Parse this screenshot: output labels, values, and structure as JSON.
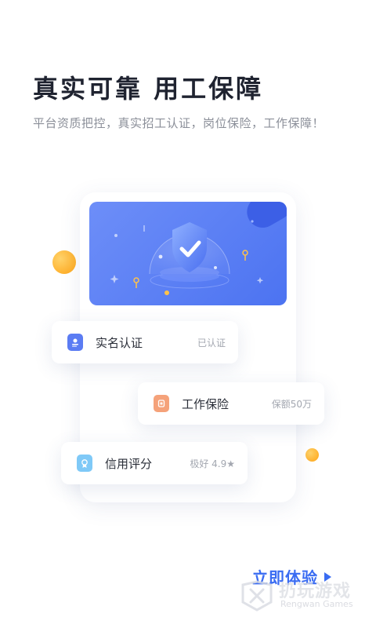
{
  "header": {
    "title": "真实可靠  用工保障",
    "subtitle": "平台资质把控，真实招工认证，岗位保险，工作保障！"
  },
  "hero": {
    "illustration": "shield-check-illustration"
  },
  "cards": [
    {
      "label": "实名认证",
      "meta": "已认证",
      "icon": "id-card-icon",
      "icon_color": "#5b7cf3"
    },
    {
      "label": "工作保险",
      "meta": "保额50万",
      "icon": "insurance-badge-icon",
      "icon_color": "#f5a27a"
    },
    {
      "label": "信用评分",
      "meta": "极好  4.9★",
      "icon": "credit-award-icon",
      "icon_color": "#7fc9f7"
    }
  ],
  "cta": {
    "label": "立即体验"
  },
  "watermark": {
    "name": "扔玩游戏",
    "sub": "Rengwan Games"
  },
  "colors": {
    "accent": "#3a6cf2",
    "hero_start": "#6d8ef8",
    "hero_end": "#4c73f1",
    "ball": "#ffb22e",
    "title": "#1f2330",
    "subtitle": "#8b8f99"
  }
}
